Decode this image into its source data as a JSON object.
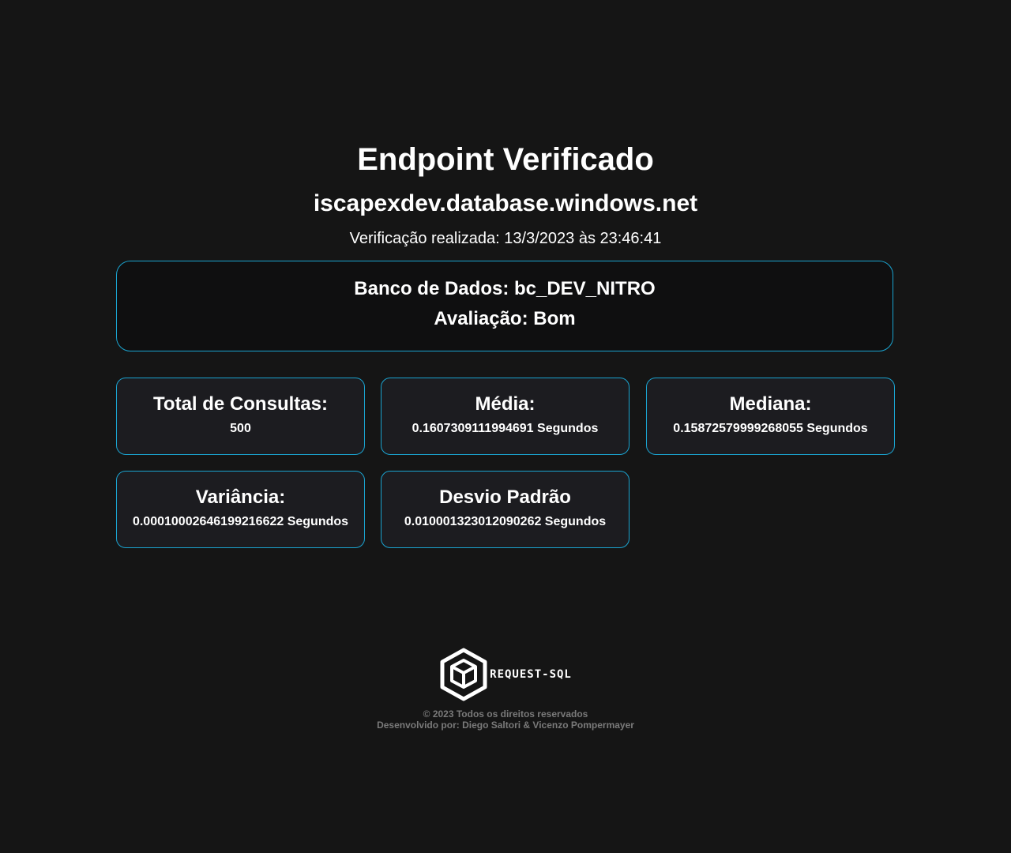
{
  "header": {
    "title": "Endpoint Verificado",
    "host": "iscapexdev.database.windows.net",
    "checked_at": "Verificação realizada: 13/3/2023 às 23:46:41"
  },
  "database": {
    "name_line": "Banco de Dados: bc_DEV_NITRO",
    "rating_line": "Avaliação: Bom"
  },
  "stats": [
    {
      "label": "Total de Consultas:",
      "value": "500"
    },
    {
      "label": "Média:",
      "value": "0.1607309111994691 Segundos"
    },
    {
      "label": "Mediana:",
      "value": "0.15872579999268055 Segundos"
    },
    {
      "label": "Variância:",
      "value": "0.00010002646199216622 Segundos"
    },
    {
      "label": "Desvio Padrão",
      "value": "0.010001323012090262 Segundos"
    }
  ],
  "footer": {
    "logo_text": "REQUEST-SQL",
    "copyright": "© 2023 Todos os direitos reservados",
    "developers": "Desenvolvido por: Diego Saltori & Vicenzo Pompermayer"
  },
  "colors": {
    "background": "#151515",
    "accent_border": "#1aa3cf",
    "card_background": "#1c1c20",
    "footer_text": "#7a7a7a"
  }
}
